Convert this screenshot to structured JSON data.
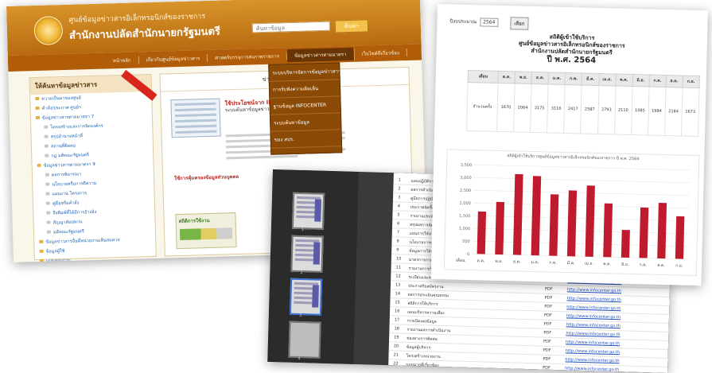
{
  "website": {
    "header_line1": "ศูนย์ข้อมูลข่าวสารอิเล็กทรอนิกส์ของราชการ",
    "header_line2": "สำนักงานปลัดสำนักนายกรัฐมนตรี",
    "search_placeholder": "ค้นหาข้อมูล",
    "search_button": "ค้นหา",
    "nav": [
      "หน้าหลัก",
      "เกี่ยวกับศูนย์ข้อมูลข่าวสาร",
      "ศาสตร์บรรจุการส่งภาพราชการ",
      "ข้อมูลข่าวสารตามมาตรา",
      "เว็บไซต์ที่เกี่ยวข้อง"
    ],
    "dropdown": [
      "ระบบบริหารจัดการข้อมูลข่าวสาร",
      "การรับฟังความคิดเห็น",
      "ฐานข้อมูล INFOCENTER",
      "ระบบค้นหาข้อมูล",
      "ของ สปร."
    ],
    "sidebar_title": "ให้ค้นหาข้อมูลข่าวสาร",
    "sidebar_items": [
      {
        "label": "ความเป็นมาของศูนย์",
        "sub": false
      },
      {
        "label": "คำสั่ง/ประกาศ ศูนย์ฯ",
        "sub": false
      },
      {
        "label": "ข้อมูลข่าวสารตามมาตรา 7",
        "sub": false
      },
      {
        "label": "โครงสร้างและการจัดองค์กร",
        "sub": true
      },
      {
        "label": "สรุปอำนาจหน้าที่",
        "sub": true
      },
      {
        "label": "สถานที่ติดต่อ",
        "sub": true
      },
      {
        "label": "กฎ มติคณะรัฐมนตรี",
        "sub": true
      },
      {
        "label": "ข้อมูลข่าวสารตามมาตรา 9",
        "sub": false
      },
      {
        "label": "ผลการพิจารณา",
        "sub": true
      },
      {
        "label": "นโยบายหรือการตีความ",
        "sub": true
      },
      {
        "label": "แผนงาน โครงการ",
        "sub": true
      },
      {
        "label": "คู่มือหรือคำสั่ง",
        "sub": true
      },
      {
        "label": "สิ่งพิมพ์ที่ได้มีการอ้างอิง",
        "sub": true
      },
      {
        "label": "สัญญาสัมปทาน",
        "sub": true
      },
      {
        "label": "มติคณะรัฐมนตรี",
        "sub": true
      },
      {
        "label": "ข้อมูลข่าวสารอื่นที่หน่วยงานเห็นสมควร",
        "sub": false
      },
      {
        "label": "ข้อมูลผู้ใช้",
        "sub": false
      },
      {
        "label": "แบบสอบถาม",
        "sub": false
      },
      {
        "label": "สถิติการเข้าใช้บริการ",
        "sub": false
      }
    ],
    "main_heading": "ข่าวประชาสัมพันธ์",
    "news_title": "ใช้ประโยชน์จาก INFOCENTER",
    "news_desc": "ระบบค้นหาข้อมูลข่าวสารของราชการ เพื่อประชาชน",
    "news2": "ใช้การคุ้มครองข้อมูลส่วนบุคคล",
    "thumb2_title": "สถิติการใช้งาน"
  },
  "report": {
    "year_select_label": "ปีงบประมาณ",
    "year_select_value": "2564",
    "select_button": "เลือก",
    "title_line1": "สถิติผู้เข้าใช้บริการ",
    "title_line2": "ศูนย์ข้อมูลข่าวสารอิเล็กทรอนิกส์ของราชการ",
    "title_line3": "สำนักงานปลัดสำนักนายกรัฐมนตรี",
    "title_year": "ปี พ.ศ. 2564",
    "row_label": "จำนวนครั้ง",
    "month_header": "เดือน",
    "chart_title": "สถิติผู้เข้าใช้บริการศูนย์ข้อมูลข่าวสารอิเล็กทรอนิกส์ของราชการ ปี พ.ศ. 2564"
  },
  "chart_data": {
    "type": "bar",
    "categories": [
      "ต.ค.",
      "พ.ย.",
      "ธ.ค.",
      "ม.ค.",
      "ก.พ.",
      "มี.ค.",
      "เม.ย.",
      "พ.ค.",
      "มิ.ย.",
      "ก.ค.",
      "ส.ค.",
      "ก.ย."
    ],
    "values": [
      1670,
      2064,
      3175,
      3116,
      2417,
      2587,
      2793,
      2110,
      1085,
      1984,
      2184,
      1673
    ],
    "title": "สถิติผู้เข้าใช้บริการศูนย์ข้อมูลข่าวสารอิเล็กทรอนิกส์ของราชการ ปี พ.ศ. 2564",
    "xlabel": "เดือน",
    "ylabel": "",
    "ylim": [
      0,
      3500
    ],
    "color": "#c01b2c"
  },
  "tableview": {
    "rows": [
      {
        "no": "1",
        "name": "แผนปฏิบัติราชการประจำปี",
        "type": "PDF",
        "link": "http://www.infocenter.go.th"
      },
      {
        "no": "2",
        "name": "ผลการดำเนินงาน",
        "type": "PDF",
        "link": "http://www.infocenter.go.th"
      },
      {
        "no": "3",
        "name": "คู่มือการปฏิบัติงาน",
        "type": "PDF",
        "link": "http://www.infocenter.go.th"
      },
      {
        "no": "4",
        "name": "ประกาศจัดซื้อจัดจ้าง",
        "type": "PDF",
        "link": "http://www.infocenter.go.th"
      },
      {
        "no": "5",
        "name": "รายงานประจำปี",
        "type": "PDF",
        "link": "http://www.infocenter.go.th"
      },
      {
        "no": "6",
        "name": "สรุปผลการจัดซื้อจัดจ้าง",
        "type": "PDF",
        "link": "http://www.infocenter.go.th"
      },
      {
        "no": "7",
        "name": "แผนการใช้จ่ายงบประมาณ",
        "type": "PDF",
        "link": "http://www.infocenter.go.th"
      },
      {
        "no": "8",
        "name": "นโยบายการบริหาร",
        "type": "PDF",
        "link": "http://www.infocenter.go.th"
      },
      {
        "no": "9",
        "name": "ข้อมูลการให้บริการ",
        "type": "PDF",
        "link": "http://www.infocenter.go.th"
      },
      {
        "no": "10",
        "name": "มาตรการภายในหน่วยงาน",
        "type": "PDF",
        "link": "http://www.infocenter.go.th"
      },
      {
        "no": "11",
        "name": "รายงานการกำกับติดตาม",
        "type": "PDF",
        "link": "http://www.infocenter.go.th"
      },
      {
        "no": "12",
        "name": "ระเบียบและหลักเกณฑ์",
        "type": "PDF",
        "link": "http://www.infocenter.go.th"
      },
      {
        "no": "13",
        "name": "ประกาศรับสมัครงาน",
        "type": "PDF",
        "link": "http://www.infocenter.go.th"
      },
      {
        "no": "14",
        "name": "ผลการประเมินคุณธรรม",
        "type": "PDF",
        "link": "http://www.infocenter.go.th"
      },
      {
        "no": "15",
        "name": "สถิติการให้บริการ",
        "type": "PDF",
        "link": "http://www.infocenter.go.th"
      },
      {
        "no": "16",
        "name": "แผนบริหารความเสี่ยง",
        "type": "PDF",
        "link": "http://www.infocenter.go.th"
      },
      {
        "no": "17",
        "name": "การเปิดเผยข้อมูล",
        "type": "PDF",
        "link": "http://www.infocenter.go.th"
      },
      {
        "no": "18",
        "name": "รายงานผลการดำเนินงาน",
        "type": "PDF",
        "link": "http://www.infocenter.go.th"
      },
      {
        "no": "19",
        "name": "ช่องทางการติดต่อ",
        "type": "PDF",
        "link": "http://www.infocenter.go.th"
      },
      {
        "no": "20",
        "name": "ข้อมูลผู้บริหาร",
        "type": "PDF",
        "link": "http://www.infocenter.go.th"
      },
      {
        "no": "21",
        "name": "โครงสร้างหน่วยงาน",
        "type": "PDF",
        "link": "http://www.infocenter.go.th"
      },
      {
        "no": "22",
        "name": "กฎหมายที่เกี่ยวข้อง",
        "type": "PDF",
        "link": "http://www.infocenter.go.th"
      }
    ],
    "thumb_numbers": [
      "1",
      "2",
      "3",
      "4"
    ]
  }
}
